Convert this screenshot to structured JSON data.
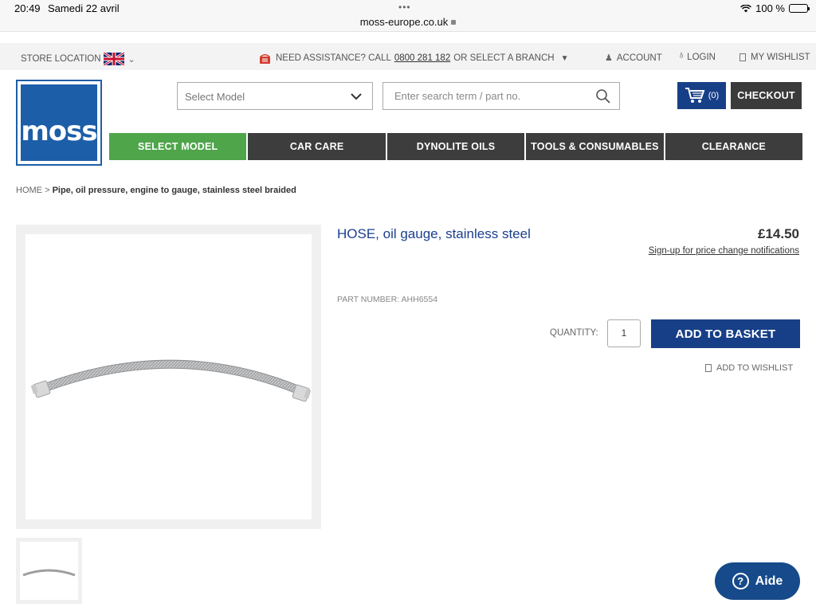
{
  "status_bar": {
    "time": "20:49",
    "date": "Samedi 22 avril",
    "url": "moss-europe.co.uk",
    "battery": "100 %"
  },
  "util_bar": {
    "store_location": "STORE LOCATION",
    "assist_prefix": "NEED ASSISTANCE? CALL",
    "phone": "0800 281 182",
    "assist_suffix": "OR SELECT A BRANCH",
    "account": "ACCOUNT",
    "login": "LOGIN",
    "wishlist": "MY WISHLIST"
  },
  "logo": {
    "text": "moss"
  },
  "header": {
    "select_model_placeholder": "Select Model",
    "search_placeholder": "Enter search term / part no.",
    "cart_count": "(0)",
    "checkout": "CHECKOUT"
  },
  "nav": {
    "items": [
      {
        "label": "SELECT MODEL",
        "active": true
      },
      {
        "label": "CAR CARE"
      },
      {
        "label": "DYNOLITE OILS"
      },
      {
        "label": "TOOLS & CONSUMABLES"
      },
      {
        "label": "CLEARANCE"
      }
    ]
  },
  "breadcrumb": {
    "home": "HOME",
    "separator": ">",
    "current": "Pipe, oil pressure, engine to gauge, stainless steel braided"
  },
  "product": {
    "title": "HOSE, oil gauge, stainless steel",
    "price": "£14.50",
    "price_alert": "Sign-up for price change notifications",
    "part_number": "PART NUMBER: AHH6554",
    "quantity_label": "QUANTITY:",
    "quantity": "1",
    "add_to_basket": "ADD TO BASKET",
    "add_to_wishlist": "ADD TO WISHLIST"
  },
  "chat": {
    "label": "Aide"
  },
  "colors": {
    "brand_blue": "#1d5ea8",
    "button_blue": "#173f87",
    "nav_dark": "#3d3d3d",
    "nav_active": "#4ea54a",
    "title_blue": "#1b3f8f"
  }
}
